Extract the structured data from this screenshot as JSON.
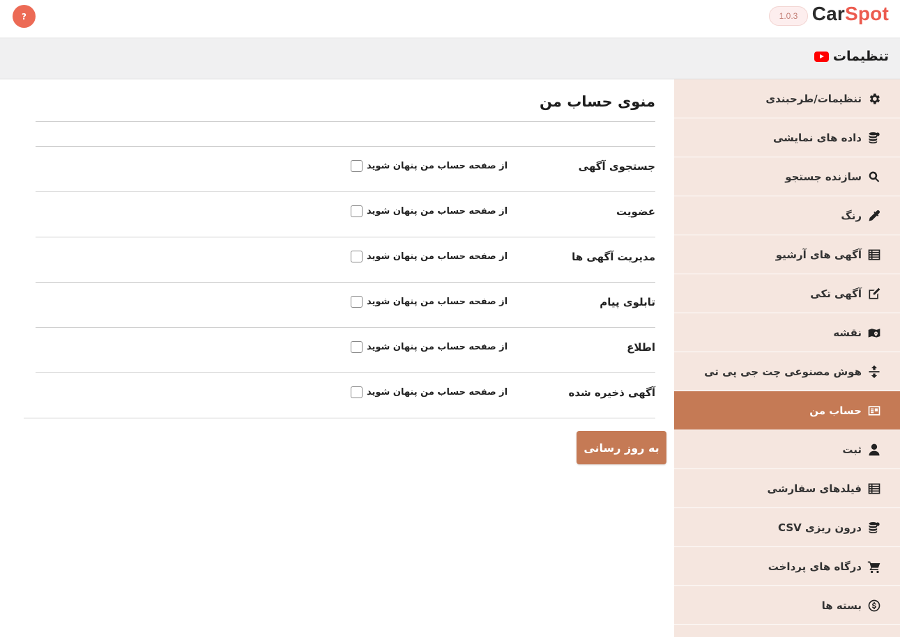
{
  "topbar": {
    "help_label": "?",
    "logo_part1": "Car",
    "logo_part2": "Spot",
    "version": "1.0.3"
  },
  "header": {
    "title": "تنظیمات"
  },
  "sidebar": {
    "items": [
      {
        "label": "تنظیمات/طرحبندی",
        "icon": "gear-icon"
      },
      {
        "label": "داده های نمایشی",
        "icon": "database-icon"
      },
      {
        "label": "سازنده جستجو",
        "icon": "search-icon"
      },
      {
        "label": "رنگ",
        "icon": "eyedropper-icon"
      },
      {
        "label": "آگهی های آرشیو",
        "icon": "list-icon"
      },
      {
        "label": "آگهی تکی",
        "icon": "edit-icon"
      },
      {
        "label": "نقشه",
        "icon": "map-icon"
      },
      {
        "label": "هوش مصنوعی چت جی پی تی",
        "icon": "ai-icon"
      },
      {
        "label": "حساب من",
        "icon": "account-icon",
        "active": true
      },
      {
        "label": "ثبت",
        "icon": "user-icon"
      },
      {
        "label": "فیلدهای سفارشی",
        "icon": "list-icon"
      },
      {
        "label": "درون ریزی CSV",
        "icon": "database-icon"
      },
      {
        "label": "درگاه های پرداخت",
        "icon": "cart-icon"
      },
      {
        "label": "بسته ها",
        "icon": "dollar-icon"
      }
    ]
  },
  "main": {
    "title": "منوی حساب من",
    "checkbox_text": "از صفحه حساب من پنهان شوید",
    "rows": [
      {
        "label": "جستجوی آگهی",
        "checked": false
      },
      {
        "label": "عضویت",
        "checked": false
      },
      {
        "label": "مدیریت آگهی ها",
        "checked": false
      },
      {
        "label": "تابلوی پیام",
        "checked": false
      },
      {
        "label": "اطلاع",
        "checked": false
      },
      {
        "label": "آگهی ذخیره شده",
        "checked": false
      }
    ],
    "update_button": "به روز رسانی"
  },
  "colors": {
    "accent": "#c57a55",
    "sidebar_bg": "#f5e6df",
    "brand_red": "#ec5b4f",
    "help_red": "#ec6a55"
  }
}
